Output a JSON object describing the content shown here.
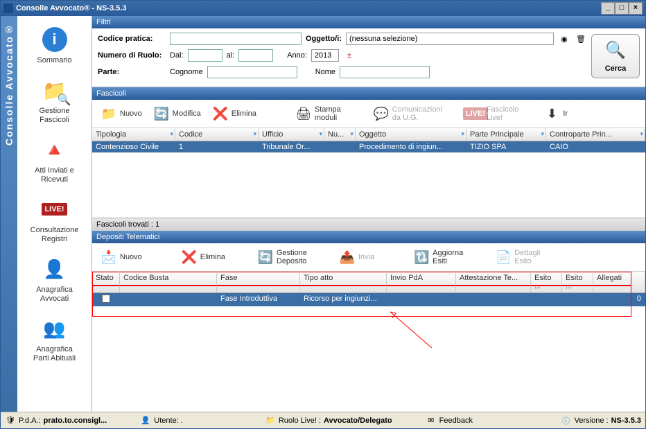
{
  "window": {
    "title": "Consolle Avvocato® - NS-3.5.3"
  },
  "vertical_title": "Consolle Avvocato®",
  "sidebar": {
    "items": [
      {
        "label": "Sommario"
      },
      {
        "label": "Gestione\nFascicoli"
      },
      {
        "label": "Atti Inviati e\nRicevuti"
      },
      {
        "label": "Consultazione\nRegistri"
      },
      {
        "label": "Anagrafica\nAvvocati"
      },
      {
        "label": "Anagrafica\nParti Abituali"
      }
    ]
  },
  "filters": {
    "header": "Filtri",
    "codice_pratica_label": "Codice pratica:",
    "oggetto_label": "Oggetto/i:",
    "oggetto_value": "(nessuna selezione)",
    "numero_ruolo_label": "Numero di Ruolo:",
    "dal_label": "Dal:",
    "al_label": "al:",
    "anno_label": "Anno:",
    "anno_value": "2013",
    "parte_label": "Parte:",
    "cognome_label": "Cognome",
    "nome_label": "Nome",
    "cerca_label": "Cerca"
  },
  "fascicoli": {
    "header": "Fascicoli",
    "toolbar": {
      "nuovo": "Nuovo",
      "modifica": "Modifica",
      "elimina": "Elimina",
      "stampa_moduli": "Stampa\nmoduli",
      "comunicazioni": "Comunicazioni\nda U.G.",
      "fascicolo_live": "Fascicolo\nLive!",
      "import": "Ir"
    },
    "columns": [
      "Tipologia",
      "Codice",
      "Ufficio",
      "Nu...",
      "Oggetto",
      "Parte Principale",
      "Controparte Prin..."
    ],
    "row": {
      "tipologia": "Contenzioso Civile",
      "codice": "1",
      "ufficio": "Tribunale Or...",
      "numero": "",
      "oggetto": "Procedimento di ingiun...",
      "parte": "TIZIO SPA",
      "controparte": "CAIO"
    },
    "found_label": "Fascicoli trovati :  1"
  },
  "depositi": {
    "header": "Depositi Telematici",
    "toolbar": {
      "nuovo": "Nuovo",
      "elimina": "Elimina",
      "gestione_deposito": "Gestione\nDeposito",
      "invia": "Invia",
      "aggiorna_esiti": "Aggiorna\nEsiti",
      "dettagli_esito": "Dettagli\nEsito"
    },
    "columns": [
      "Stato",
      "Codice Busta",
      "Fase",
      "Tipo atto",
      "Invio PdA",
      "Attestazione Te...",
      "Esito ...",
      "Esito ...",
      "Allegati"
    ],
    "row": {
      "stato": "",
      "codice_busta": "",
      "fase": "Fase Introduttiva",
      "tipo_atto": "Ricorso per ingiunzi...",
      "invio_pda": "",
      "attestazione": "",
      "esito1": "",
      "esito2": "",
      "allegati": "0"
    }
  },
  "statusbar": {
    "pda_label": "P.d.A.:",
    "pda_value": "prato.to.consigl...",
    "utente_label": "Utente: .",
    "ruolo_label": "Ruolo Live! :",
    "ruolo_value": "Avvocato/Delegato",
    "feedback": "Feedback",
    "versione_label": "Versione :",
    "versione_value": "NS-3.5.3"
  }
}
